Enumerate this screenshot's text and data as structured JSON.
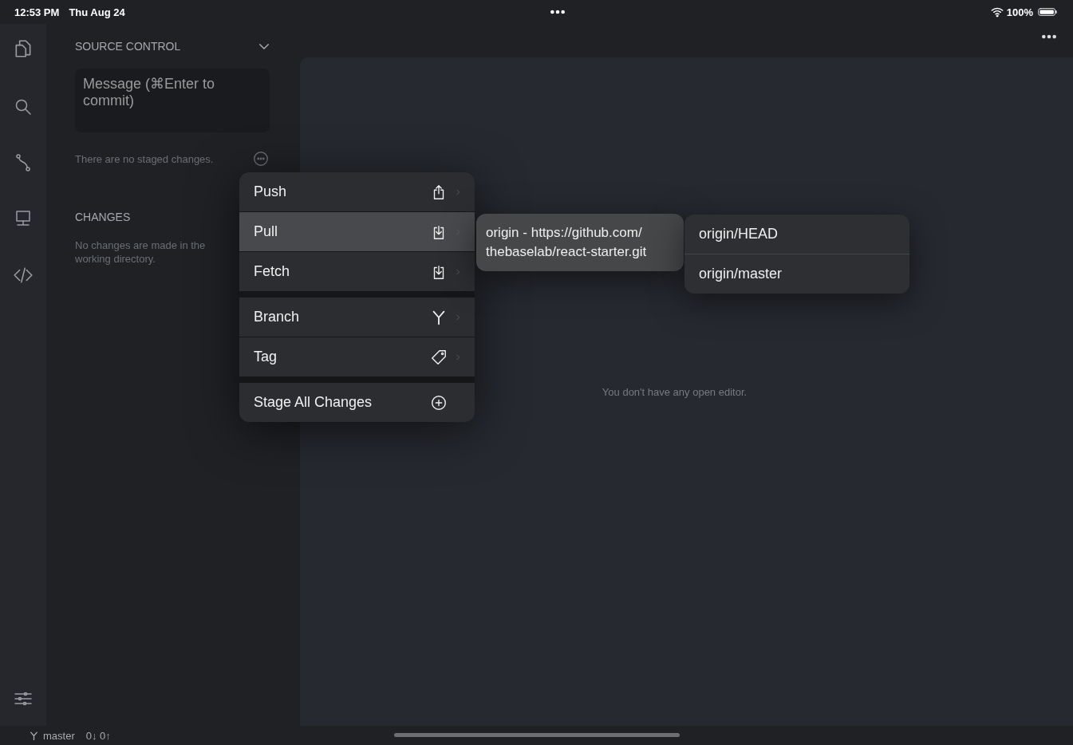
{
  "status_bar": {
    "time": "12:53 PM",
    "date": "Thu Aug 24",
    "battery": "100%"
  },
  "sidebar": {
    "title": "SOURCE CONTROL",
    "message_field": {
      "placeholder": "Message (⌘Enter to commit)"
    },
    "staged_note": "There are no staged changes.",
    "changes_title": "CHANGES",
    "changes_note": "No changes are made in the working directory."
  },
  "context_menu": {
    "groups": [
      [
        {
          "label": "Push",
          "kind": "upload",
          "submenu": true,
          "selected": false
        },
        {
          "label": "Pull",
          "kind": "download",
          "submenu": true,
          "selected": true
        },
        {
          "label": "Fetch",
          "kind": "download",
          "submenu": true,
          "selected": false
        }
      ],
      [
        {
          "label": "Branch",
          "kind": "branch",
          "submenu": true,
          "selected": false
        },
        {
          "label": "Tag",
          "kind": "tag",
          "submenu": true,
          "selected": false
        }
      ],
      [
        {
          "label": "Stage All Changes",
          "kind": "plus",
          "submenu": false,
          "selected": false
        }
      ]
    ]
  },
  "remote_menu": {
    "items": [
      {
        "label": "origin - https://github.com/thebaselab/react-starter.git"
      }
    ]
  },
  "branch_menu": {
    "items": [
      {
        "label": "origin/HEAD"
      },
      {
        "label": "origin/master"
      }
    ]
  },
  "editor": {
    "empty_note": "You don't have any open editor."
  },
  "bottom_bar": {
    "branch": "master",
    "sync": "0↓ 0↑"
  }
}
